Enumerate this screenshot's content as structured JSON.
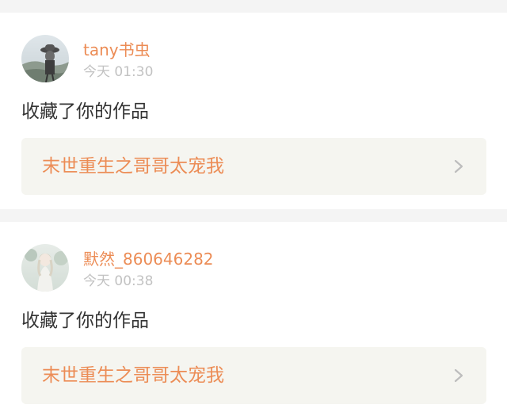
{
  "feed": [
    {
      "username": "tany书虫",
      "time": "今天 01:30",
      "action": "收藏了你的作品",
      "work_title": "末世重生之哥哥太宠我"
    },
    {
      "username": "默然_860646282",
      "time": "今天 00:38",
      "action": "收藏了你的作品",
      "work_title": "末世重生之哥哥太宠我"
    }
  ],
  "icons": {
    "chevron": "chevron-right-icon"
  },
  "colors": {
    "accent": "#ec8c55",
    "text": "#333333",
    "muted": "#c2c2c2",
    "link_bg": "#f5f5f0",
    "page_bg": "#f4f4f4"
  }
}
